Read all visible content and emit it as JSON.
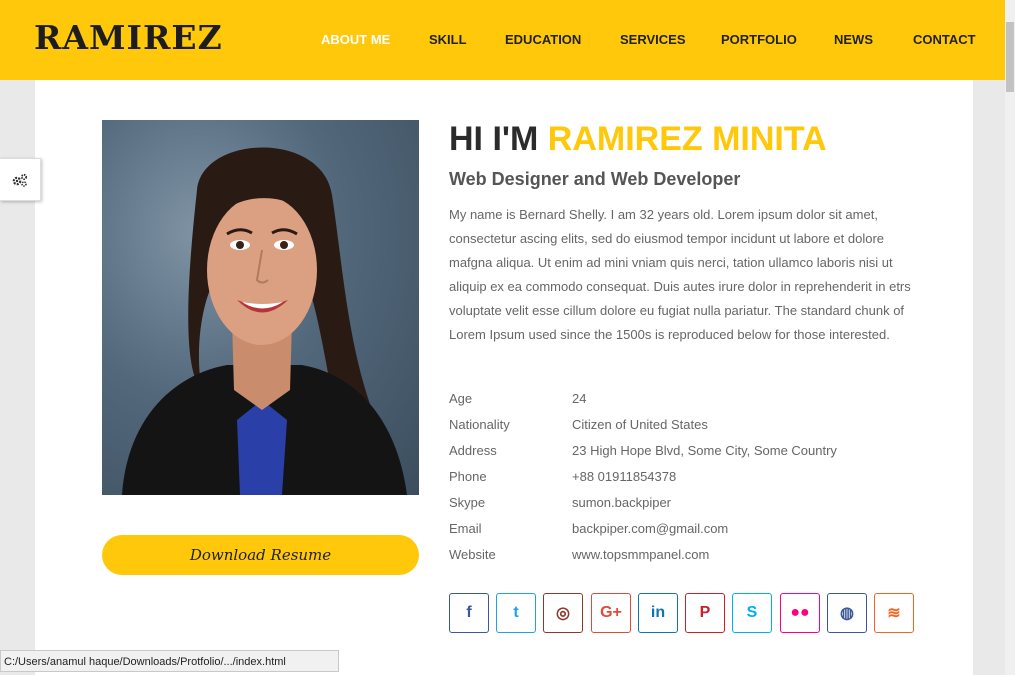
{
  "header": {
    "brand": "RAMIREZ",
    "nav": [
      {
        "label": "ABOUT ME",
        "active": true
      },
      {
        "label": "SKILL"
      },
      {
        "label": "EDUCATION"
      },
      {
        "label": "SERVICES"
      },
      {
        "label": "PORTFOLIO"
      },
      {
        "label": "NEWS"
      },
      {
        "label": "CONTACT"
      }
    ]
  },
  "about": {
    "greeting": "HI I'M",
    "name": "RAMIREZ MINITA",
    "subtitle": "Web Designer and Web Developer",
    "bio": "My name is Bernard Shelly. I am 32 years old. Lorem ipsum dolor sit amet, consectetur ascing elits, sed do eiusmod tempor incidunt ut labore et dolore mafgna aliqua. Ut enim ad mini vniam quis nerci, tation ullamco laboris nisi ut aliquip ex ea commodo consequat. Duis autes irure dolor in reprehenderit in etrs voluptate velit esse cillum dolore eu fugiat nulla pariatur. The standard chunk of Lorem Ipsum used since the 1500s is reproduced below for those interested.",
    "download_label": "Download Resume",
    "info": [
      {
        "key": "Age",
        "value": "24"
      },
      {
        "key": "Nationality",
        "value": "Citizen of United States"
      },
      {
        "key": "Address",
        "value": "23 High Hope Blvd, Some City, Some Country"
      },
      {
        "key": "Phone",
        "value": "+88 01911854378"
      },
      {
        "key": "Skype",
        "value": "sumon.backpiper"
      },
      {
        "key": "Email",
        "value": "backpiper.com@gmail.com"
      },
      {
        "key": "Website",
        "value": "www.topsmmpanel.com"
      }
    ]
  },
  "social": [
    {
      "icon": "facebook-icon",
      "glyph": "f",
      "color": "#3b5998"
    },
    {
      "icon": "twitter-icon",
      "glyph": "t",
      "color": "#1da1f2"
    },
    {
      "icon": "instagram-icon",
      "glyph": "◎",
      "color": "#8a3a2a"
    },
    {
      "icon": "google-plus-icon",
      "glyph": "G+",
      "color": "#dd4b39"
    },
    {
      "icon": "linkedin-icon",
      "glyph": "in",
      "color": "#0e76a8"
    },
    {
      "icon": "pinterest-icon",
      "glyph": "P",
      "color": "#cb2027"
    },
    {
      "icon": "skype-icon",
      "glyph": "S",
      "color": "#00aff0"
    },
    {
      "icon": "flickr-icon",
      "glyph": "●●",
      "color": "#ff0084"
    },
    {
      "icon": "dribbble-icon",
      "glyph": "◍",
      "color": "#3b5998"
    },
    {
      "icon": "rss-icon",
      "glyph": "≋",
      "color": "#f26522"
    }
  ],
  "status_url": "C:/Users/anamul haque/Downloads/Protfolio/.../index.html",
  "colors": {
    "accent": "#ffc80a",
    "dark": "#222222"
  }
}
